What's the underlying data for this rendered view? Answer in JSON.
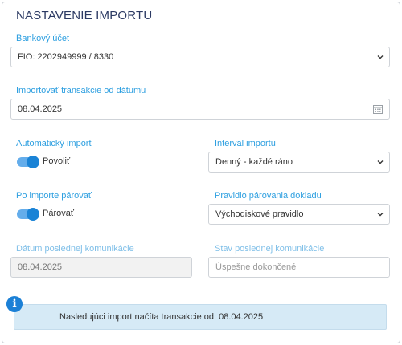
{
  "title": "NASTAVENIE IMPORTU",
  "bank_account": {
    "label": "Bankový účet",
    "value": "FIO: 2202949999 / 8330"
  },
  "import_from": {
    "label": "Importovať transakcie od dátumu",
    "value": "08.04.2025"
  },
  "auto_import": {
    "label": "Automatický import",
    "toggle_label": "Povoliť",
    "enabled": true
  },
  "interval": {
    "label": "Interval importu",
    "value": "Denný - každé ráno"
  },
  "pairing": {
    "label": "Po importe párovať",
    "toggle_label": "Párovať",
    "enabled": true
  },
  "pairing_rule": {
    "label": "Pravidlo párovania dokladu",
    "value": "Východiskové pravidlo"
  },
  "last_comm_date": {
    "label": "Dátum poslednej komunikácie",
    "value": "08.04.2025"
  },
  "last_comm_status": {
    "label": "Stav poslednej komunikácie",
    "value": "Úspešne dokončené"
  },
  "info": {
    "icon": "info-icon",
    "glyph": "i",
    "text": "Nasledujúci import načíta transakcie od: 08.04.2025"
  },
  "colors": {
    "accent": "#2d9fe0",
    "toggle": "#1a83d6",
    "info_bg": "#d6eaf6",
    "title": "#2c3a63"
  }
}
